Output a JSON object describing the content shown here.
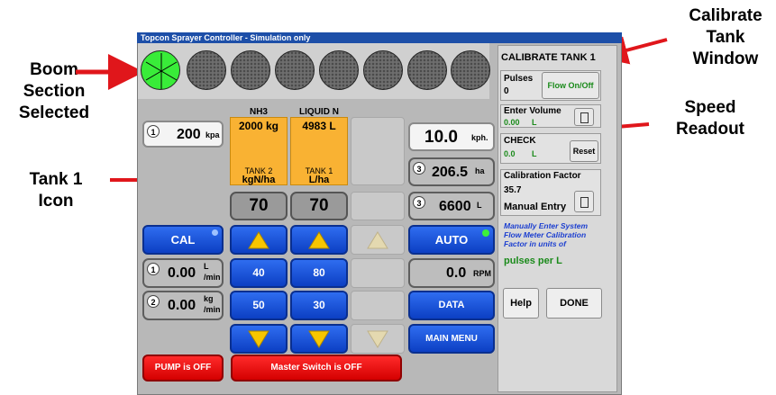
{
  "window": {
    "title": "Topcon Sprayer Controller  - Simulation only"
  },
  "annotations": {
    "boom": "Boom Section Selected",
    "tank_icon": "Tank 1 Icon",
    "calibrate": "Calibrate Tank Window",
    "speed": "Speed Readout"
  },
  "booms": [
    {
      "selected": true
    },
    {
      "selected": false
    },
    {
      "selected": false
    },
    {
      "selected": false
    },
    {
      "selected": false
    },
    {
      "selected": false
    },
    {
      "selected": false
    },
    {
      "selected": false
    }
  ],
  "pressure": {
    "value": "200",
    "unit": "kpa",
    "index": "1"
  },
  "tank2": {
    "header": "NH3",
    "amount": "2000 kg",
    "label1": "TANK 2",
    "label2": "kgN/ha",
    "rate": "70",
    "step1": "40",
    "step2": "50",
    "color": "#f9b233"
  },
  "tank1": {
    "header": "LIQUID N",
    "amount": "4983 L",
    "label1": "TANK 1",
    "label2": "L/ha",
    "rate": "70",
    "step1": "80",
    "step2": "30",
    "color": "#f9b233"
  },
  "cal_button": "CAL",
  "flow1": {
    "value": "0.00",
    "unit_top": "L",
    "unit_bottom": "/min",
    "index": "1"
  },
  "flow2": {
    "value": "0.00",
    "unit_top": "kg",
    "unit_bottom": "/min",
    "index": "2"
  },
  "speed": {
    "value": "10.0",
    "unit": "kph."
  },
  "area": {
    "value": "206.5",
    "unit": "ha",
    "index": "3"
  },
  "volume": {
    "value": "6600",
    "unit": "L",
    "index": "3"
  },
  "auto_button": "AUTO",
  "rpm": {
    "value": "0.0",
    "unit": "RPM"
  },
  "data_button": "DATA",
  "main_menu_button": "MAIN MENU",
  "pump_button": "PUMP is OFF",
  "master_button": "Master Switch is OFF",
  "calibrate": {
    "title": "CALIBRATE TANK 1",
    "pulses_label": "Pulses",
    "pulses_value": "0",
    "flow_button": "Flow On/Off",
    "enter_volume_label": "Enter Volume",
    "enter_volume_value": "0.00",
    "enter_volume_unit": "L",
    "check_label": "CHECK",
    "check_value": "0.0",
    "check_unit": "L",
    "reset_button": "Reset",
    "cal_factor_label": "Calibration Factor",
    "cal_factor_value": "35.7",
    "manual_entry_label": "Manual Entry",
    "info_text": "Manually Enter System Flow Meter Calibration Factor in units of",
    "units_text": "pulses per L",
    "help_button": "Help",
    "done_button": "DONE"
  },
  "colors": {
    "accent_blue": "#0c3fc3",
    "boom_selected": "#39ec39",
    "tank_yellow": "#f9b233",
    "alert_red": "#e00000",
    "arrow_red": "#e0161b"
  }
}
